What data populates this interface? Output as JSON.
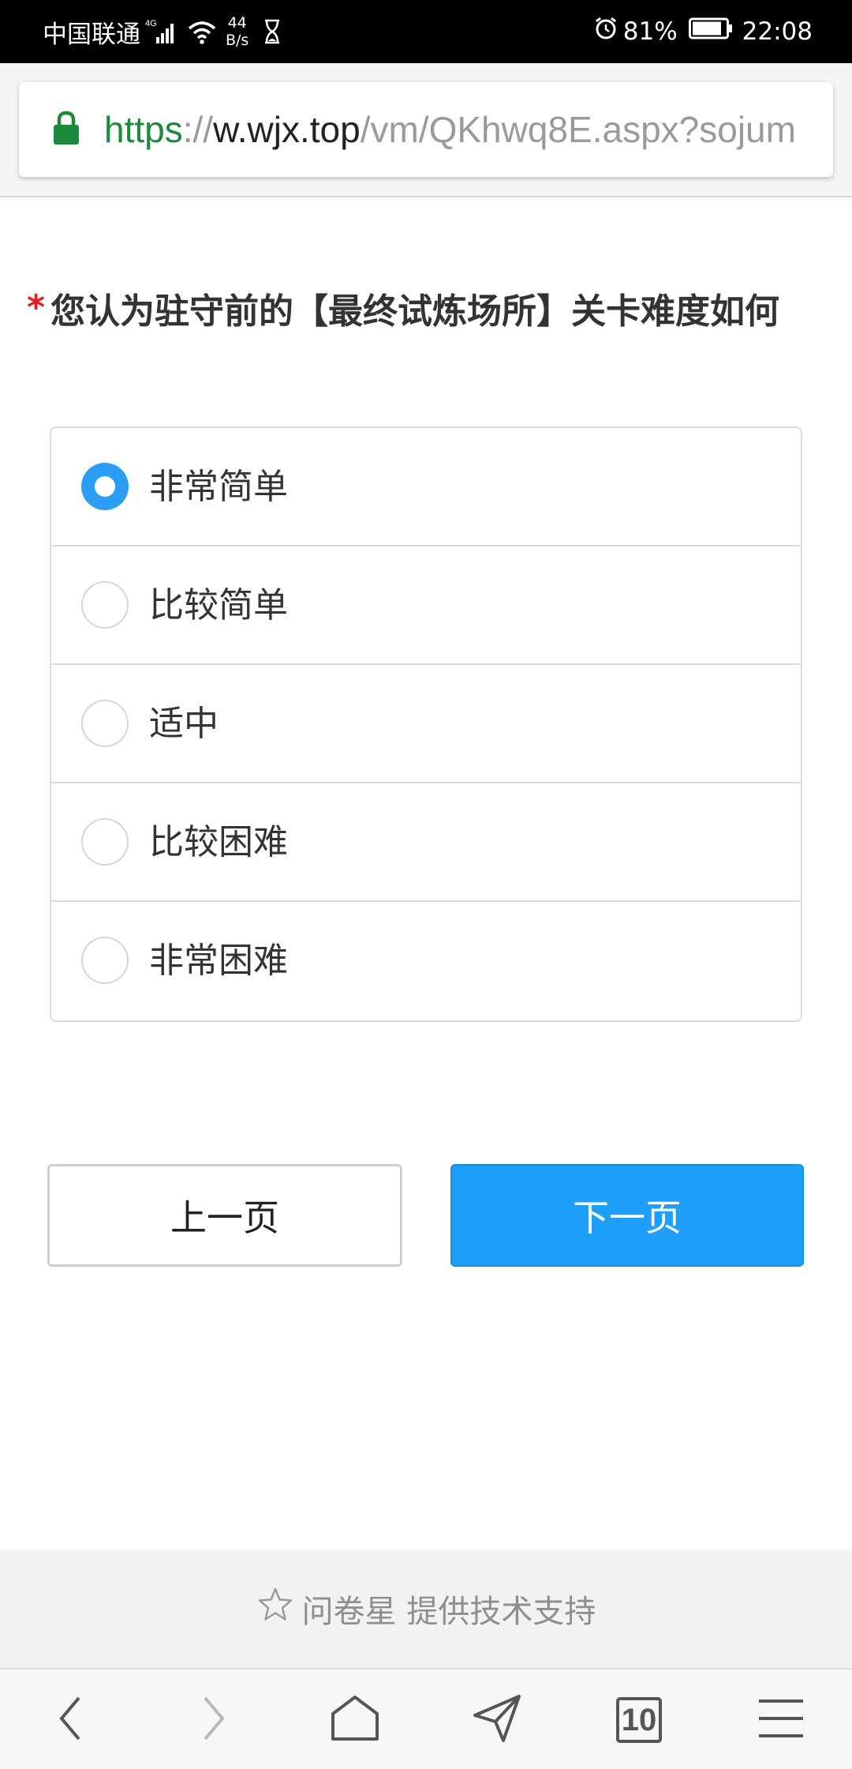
{
  "status_bar": {
    "carrier": "中国联通",
    "network": "4G",
    "speed_value": "44",
    "speed_unit": "B/s",
    "battery": "81%",
    "time": "22:08"
  },
  "browser": {
    "url_scheme": "https",
    "url_sep": "://",
    "url_host": "w.wjx.top",
    "url_path": "/vm/QKhwq8E.aspx?sojum",
    "tab_count": "10"
  },
  "question": {
    "required_mark": "*",
    "title": "您认为驻守前的【最终试炼场所】关卡难度如何",
    "options": [
      {
        "label": "非常简单",
        "checked": true
      },
      {
        "label": "比较简单",
        "checked": false
      },
      {
        "label": "适中",
        "checked": false
      },
      {
        "label": "比较困难",
        "checked": false
      },
      {
        "label": "非常困难",
        "checked": false
      }
    ]
  },
  "buttons": {
    "prev": "上一页",
    "next": "下一页"
  },
  "footer": {
    "text": "问卷星 提供技术支持"
  },
  "colors": {
    "accent": "#1ea0fa",
    "radio_checked": "#2a9df4",
    "required": "#e02020",
    "secure": "#1b8a3a"
  }
}
